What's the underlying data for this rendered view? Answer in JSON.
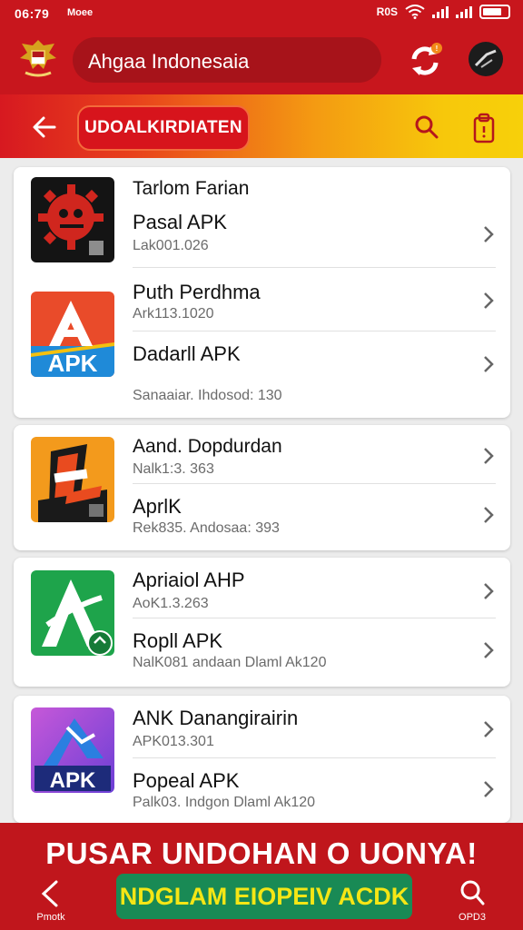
{
  "status": {
    "time": "06:79",
    "carrier": "Moee",
    "network": "R0S"
  },
  "header": {
    "search_text": "Ahgaa Indonesaia"
  },
  "subbar": {
    "pill_label": "UDOALKIRDIATEN"
  },
  "cards": [
    {
      "header": "Tarlom Farian",
      "rows": [
        {
          "title": "Pasal APK",
          "subtitle": "Lak001.026"
        },
        {
          "title": "Puth Perdhma",
          "subtitle": "Ark113.1020"
        },
        {
          "title": "Dadarll APK",
          "subtitle": "Sanaaiar. Ihdosod: 130"
        }
      ]
    },
    {
      "rows": [
        {
          "title": "Aand. Dopdurdan",
          "subtitle": "Nalk1:3. 363"
        },
        {
          "title": "AprlK",
          "subtitle": "Rek835. Andosaa: 393"
        }
      ]
    },
    {
      "rows": [
        {
          "title": "Apriaiol AHP",
          "subtitle": "AoK1.3.263"
        },
        {
          "title": "Ropll APK",
          "subtitle": "NalK081 andaan Dlaml Ak120"
        }
      ]
    },
    {
      "rows": [
        {
          "title": "ANK Danangirairin",
          "subtitle": "APK013.301"
        },
        {
          "title": "Popeal APK",
          "subtitle": "Palk03. Indgon Dlaml Ak120"
        }
      ]
    }
  ],
  "icons": {
    "card1": "APK",
    "card3": "APK"
  },
  "banner": {
    "title": "PUSAR UNDOHAN O UONYA!",
    "cta": "NDGLAM EIOPEIV ACDK",
    "nav_left": "Pmotk",
    "nav_right": "OPD3"
  },
  "colors": {
    "primary_red": "#c8161d",
    "cta_green": "#198a55",
    "cta_text": "#f5e615"
  }
}
